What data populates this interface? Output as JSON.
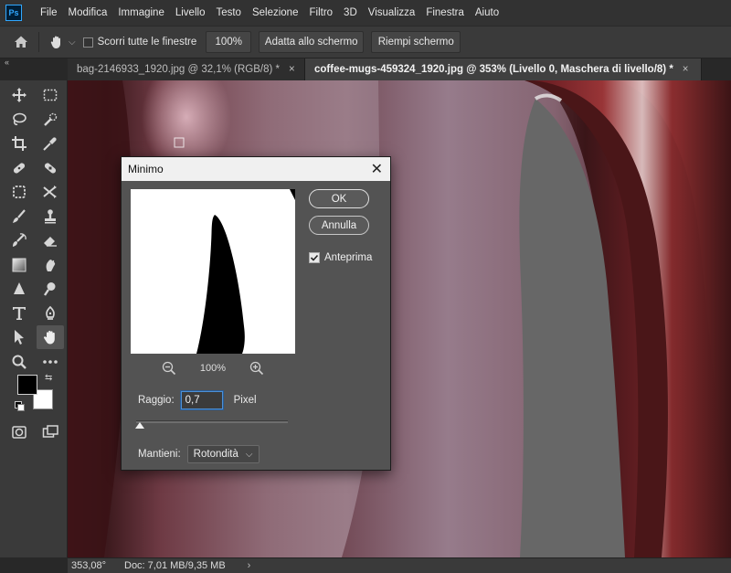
{
  "app": {
    "logo_text": "Ps"
  },
  "menu": [
    "File",
    "Modifica",
    "Immagine",
    "Livello",
    "Testo",
    "Selezione",
    "Filtro",
    "3D",
    "Visualizza",
    "Finestra",
    "Aiuto"
  ],
  "options_bar": {
    "scroll_all_label": "Scorri tutte le finestre",
    "zoom_100_label": "100%",
    "fit_screen_label": "Adatta allo schermo",
    "fill_screen_label": "Riempi schermo"
  },
  "collapse_glyph": "«",
  "tabs": [
    {
      "label": "bag-2146933_1920.jpg @ 32,1% (RGB/8) *",
      "close": "×",
      "active": false
    },
    {
      "label": "coffee-mugs-459324_1920.jpg @ 353% (Livello 0, Maschera di livello/8) *",
      "close": "×",
      "active": true
    }
  ],
  "toolbar": {
    "tools": [
      "move-icon",
      "marquee-icon",
      "lasso-icon",
      "quick-selection-icon",
      "crop-icon",
      "eyedropper-icon",
      "spot-healing-icon",
      "healing-brush-icon",
      "patch-icon",
      "content-aware-move-icon",
      "brush-icon",
      "clone-stamp-icon",
      "history-brush-icon",
      "eraser-icon",
      "gradient-icon",
      "smudge-icon",
      "sharpen-icon",
      "dodge-icon",
      "type-icon",
      "pen-icon",
      "path-selection-icon",
      "hand-icon",
      "zoom-icon",
      "more-tools-icon"
    ],
    "active_tool": "hand-icon",
    "foreground_color": "#000000",
    "background_color": "#ffffff",
    "swap_glyph": "⇆"
  },
  "status": {
    "zoom": "353,08°",
    "doc": "Doc: 7,01 MB/9,35 MB",
    "arrow": "›"
  },
  "dialog": {
    "title": "Minimo",
    "close": "✕",
    "ok_label": "OK",
    "cancel_label": "Annulla",
    "preview_label": "Anteprima",
    "preview_checked": true,
    "preview_zoom": "100%",
    "radius_label": "Raggio:",
    "radius_value": "0,7",
    "radius_unit": "Pixel",
    "preserve_label": "Mantieni:",
    "preserve_value": "Rotondità",
    "preserve_arrow": "⌵"
  },
  "colors": {
    "menubar": "#323232",
    "panel": "#3a3a3a",
    "dialog": "#535353",
    "accent_focus": "#4d90d6"
  }
}
